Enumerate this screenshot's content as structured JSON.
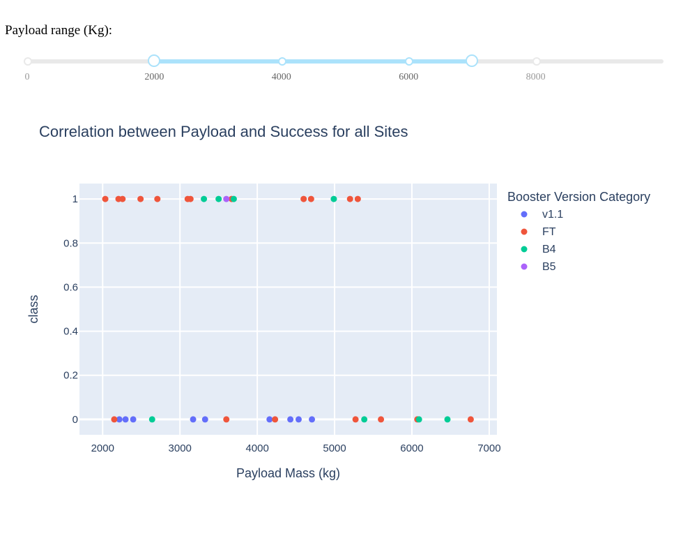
{
  "slider": {
    "label": "Payload range (Kg):",
    "min": 0,
    "max": 10000,
    "value": [
      2000,
      7000
    ],
    "marks": [
      "0",
      "2000",
      "4000",
      "6000",
      "8000"
    ],
    "mark_values": [
      0,
      2000,
      4000,
      6000,
      8000
    ],
    "track_color": "#abe2fb",
    "rail_color": "#e9e9e9"
  },
  "chart_data": {
    "type": "scatter",
    "title": "Correlation between Payload and Success for all Sites",
    "xlabel": "Payload Mass (kg)",
    "ylabel": "class",
    "xlim": [
      1700,
      7100
    ],
    "ylim": [
      -0.07,
      1.07
    ],
    "xticks": [
      2000,
      3000,
      4000,
      5000,
      6000,
      7000
    ],
    "xtick_labels": [
      "2000",
      "3000",
      "4000",
      "5000",
      "6000",
      "7000"
    ],
    "yticks": [
      0,
      0.2,
      0.4,
      0.6,
      0.8,
      1
    ],
    "ytick_labels": [
      "0",
      "0.2",
      "0.4",
      "0.6",
      "0.8",
      "1"
    ],
    "grid": true,
    "plot_bgcolor": "#e5ecf6",
    "legend": {
      "title": "Booster Version Category",
      "position": "right"
    },
    "series": [
      {
        "name": "v1.1",
        "color": "#636efa",
        "points": [
          [
            2216,
            0
          ],
          [
            2296,
            0
          ],
          [
            2395,
            0
          ],
          [
            3170,
            0
          ],
          [
            3325,
            0
          ],
          [
            4159,
            0
          ],
          [
            4428,
            0
          ],
          [
            4535,
            0
          ],
          [
            4707,
            0
          ]
        ]
      },
      {
        "name": "FT",
        "color": "#ef553b",
        "points": [
          [
            2034,
            1
          ],
          [
            2205,
            1
          ],
          [
            2257,
            1
          ],
          [
            2490,
            1
          ],
          [
            2708,
            1
          ],
          [
            3100,
            1
          ],
          [
            3136,
            1
          ],
          [
            3669,
            1
          ],
          [
            4600,
            1
          ],
          [
            4696,
            1
          ],
          [
            5200,
            1
          ],
          [
            5300,
            1
          ],
          [
            2150,
            0
          ],
          [
            3600,
            0
          ],
          [
            4230,
            0
          ],
          [
            5271,
            0
          ],
          [
            5600,
            0
          ],
          [
            6070,
            0
          ],
          [
            6761,
            0
          ]
        ]
      },
      {
        "name": "B4",
        "color": "#00cc96",
        "points": [
          [
            3310,
            1
          ],
          [
            3500,
            1
          ],
          [
            3696,
            1
          ],
          [
            4990,
            1
          ],
          [
            2640,
            0
          ],
          [
            5384,
            0
          ],
          [
            6092,
            0
          ],
          [
            6460,
            0
          ]
        ]
      },
      {
        "name": "B5",
        "color": "#ab63fa",
        "points": [
          [
            3600,
            1
          ]
        ]
      }
    ]
  }
}
